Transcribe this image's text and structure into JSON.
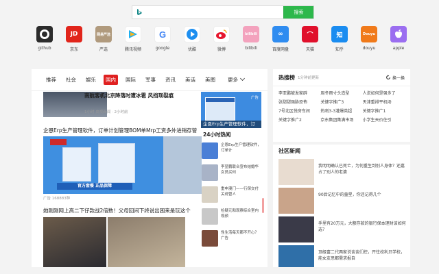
{
  "search": {
    "placeholder": "",
    "button": "搜索"
  },
  "links": [
    {
      "label": "github",
      "icon": "github-icon",
      "glyph": "⊙",
      "color": "#2b2b2b"
    },
    {
      "label": "京东",
      "icon": "jd-icon",
      "glyph": "JD",
      "color": "#e1251b"
    },
    {
      "label": "严选",
      "icon": "yanxuan-icon",
      "glyph": "网易严选",
      "color": "#b09a7d"
    },
    {
      "label": "腾讯视频",
      "icon": "tencent-video-icon",
      "glyph": "▶",
      "color": "#ffffff"
    },
    {
      "label": "google",
      "icon": "google-icon",
      "glyph": "G",
      "color": "#ffffff"
    },
    {
      "label": "优酷",
      "icon": "youku-icon",
      "glyph": "▶",
      "color": "#ffffff"
    },
    {
      "label": "微博",
      "icon": "weibo-icon",
      "glyph": "◉",
      "color": "#ffffff"
    },
    {
      "label": "bilibili",
      "icon": "bilibili-icon",
      "glyph": "bilibili",
      "color": "#f3a2bd"
    },
    {
      "label": "百度网盘",
      "icon": "baidu-netdisk-icon",
      "glyph": "∞",
      "color": "#2f8cf0"
    },
    {
      "label": "天猫",
      "icon": "tmall-icon",
      "glyph": "⌒",
      "color": "#e0102b"
    },
    {
      "label": "知乎",
      "icon": "zhihu-icon",
      "glyph": "知",
      "color": "#1a8cf0"
    },
    {
      "label": "douyu",
      "icon": "douyu-icon",
      "glyph": "Douyu",
      "color": "#f07a1a"
    },
    {
      "label": "apple",
      "icon": "apple-icon",
      "glyph": "",
      "color": "#9b6ef0"
    }
  ],
  "tabs": [
    "推荐",
    "社会",
    "娱乐",
    "国内",
    "国际",
    "军事",
    "资讯",
    "美话",
    "美图",
    "更多"
  ],
  "active_tab": "国内",
  "main": {
    "article1": {
      "title": "南航客机北京降落时遭冰雹 风挡现裂痕",
      "meta": "1小时  央视新闻 · 2小时前"
    },
    "ad1": {
      "tag": "广告",
      "caption": "企恩Erp生产管理软件，订"
    },
    "article2": {
      "title": "企恩Erp生产管理软件，订单计划管理BOM单Mrp工资多外进销存管理",
      "banner": "官方套餐  正品保障",
      "meta": "广告  168883种"
    },
    "hot_title": "24小时热闻",
    "hot": [
      {
        "text": "企恩Erp生产管理软件，订单计"
      },
      {
        "text": "李显鹏联合宣布结婚华女员买何"
      },
      {
        "text": "重申澳门——行保交付关说管人"
      },
      {
        "text": "检疑元和观察综合室内视频"
      },
      {
        "text": "性生活每天都不开心？广告"
      }
    ],
    "article3": {
      "title": "她刚刚网上高二下仔款战2倍数！父母回间下终说出困来是玩这个"
    }
  },
  "sidebar": {
    "hot_search_title": "热搜榜",
    "hot_search_sub": "1分钟前更新",
    "refresh_label": "换一换",
    "hot_search": [
      "李亚鹏被发家辟",
      "周冬雨寸头造型",
      "人说如何是强多了",
      "张甜甜强胁恐怖",
      "关键字推广3",
      "天津重排平机场",
      "7号北区悦房车间",
      "热刺3-3灌爆英超",
      "关键字推广1",
      "关键字推广2",
      "京东集团集满市场",
      "小学生天价住引"
    ],
    "community_title": "社区新闻",
    "community": [
      {
        "text": "我明明确认已死亡，为何重生到别人身体？还嘉占了别人的老婆"
      },
      {
        "text": "90后记忆中的童星，你还记得几个"
      },
      {
        "text": "手里有20万元，大额存款的银行保本理财该如何选？"
      },
      {
        "text": "顶级富二代两家说谈谈们控，开往校利贝学校，能女友思都需求报自"
      }
    ]
  }
}
